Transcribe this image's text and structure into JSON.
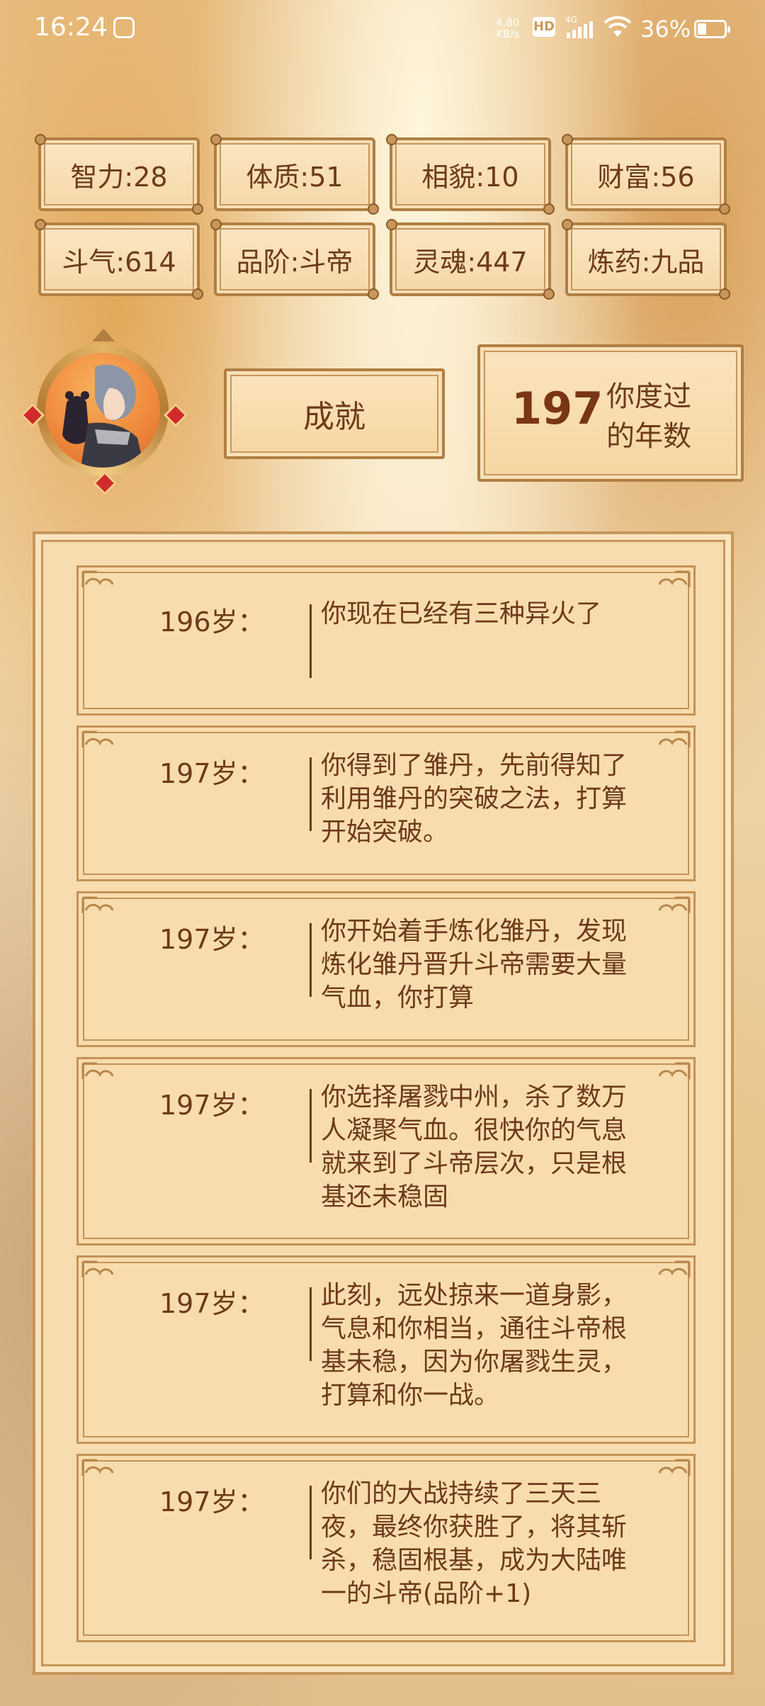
{
  "status_bar": {
    "time": "16:24",
    "net_speed_value": "4.80",
    "net_speed_unit": "KB/s",
    "hd": "HD",
    "network": "4G",
    "battery": "36%"
  },
  "stats": [
    {
      "label": "智力:28"
    },
    {
      "label": "体质:51"
    },
    {
      "label": "相貌:10"
    },
    {
      "label": "财富:56"
    },
    {
      "label": "斗气:614"
    },
    {
      "label": "品阶:斗帝"
    },
    {
      "label": "灵魂:447"
    },
    {
      "label": "炼药:九品"
    }
  ],
  "achievement_label": "成就",
  "years": {
    "value": "197",
    "label": "你度过的年数"
  },
  "log": [
    {
      "age": "196岁：",
      "text": "你现在已经有三种异火了"
    },
    {
      "age": "197岁：",
      "text": "你得到了雏丹，先前得知了利用雏丹的突破之法，打算开始突破。"
    },
    {
      "age": "197岁：",
      "text": "你开始着手炼化雏丹，发现炼化雏丹晋升斗帝需要大量气血，你打算"
    },
    {
      "age": "197岁：",
      "text": "你选择屠戮中州，杀了数万人凝聚气血。很快你的气息就来到了斗帝层次，只是根基还未稳固"
    },
    {
      "age": "197岁：",
      "text": "此刻，远处掠来一道身影，气息和你相当，通往斗帝根基未稳，因为你屠戮生灵，打算和你一战。"
    },
    {
      "age": "197岁：",
      "text": "你们的大战持续了三天三夜，最终你获胜了，将其斩杀，稳固根基，成为大陆唯一的斗帝(品阶+1)"
    }
  ]
}
